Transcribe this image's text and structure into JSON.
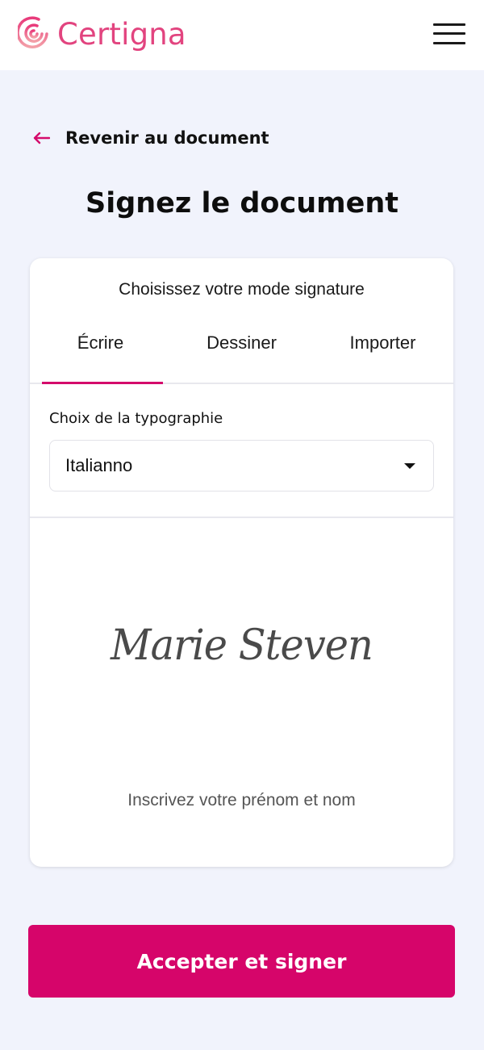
{
  "header": {
    "brand": "Certigna",
    "brand_color": "#e2447f",
    "logo_icon": "certigna-logo-icon",
    "menu_icon": "hamburger-menu-icon"
  },
  "navigation": {
    "back_label": "Revenir au document",
    "back_icon": "arrow-left-icon",
    "accent_color": "#d40b6b"
  },
  "page": {
    "title": "Signez le document"
  },
  "signature_card": {
    "prompt": "Choisissez votre mode signature",
    "tabs": [
      {
        "label": "Écrire",
        "selected": true
      },
      {
        "label": "Dessiner",
        "selected": false
      },
      {
        "label": "Importer",
        "selected": false
      }
    ],
    "typography": {
      "label": "Choix de la typographie",
      "selected": "Italianno",
      "dropdown_icon": "caret-down-icon"
    },
    "signature_preview": "Marie Steven",
    "name_input": {
      "value": "",
      "placeholder": "Inscrivez votre prénom et nom"
    }
  },
  "actions": {
    "submit_label": "Accepter et signer",
    "submit_color": "#d6056a"
  }
}
